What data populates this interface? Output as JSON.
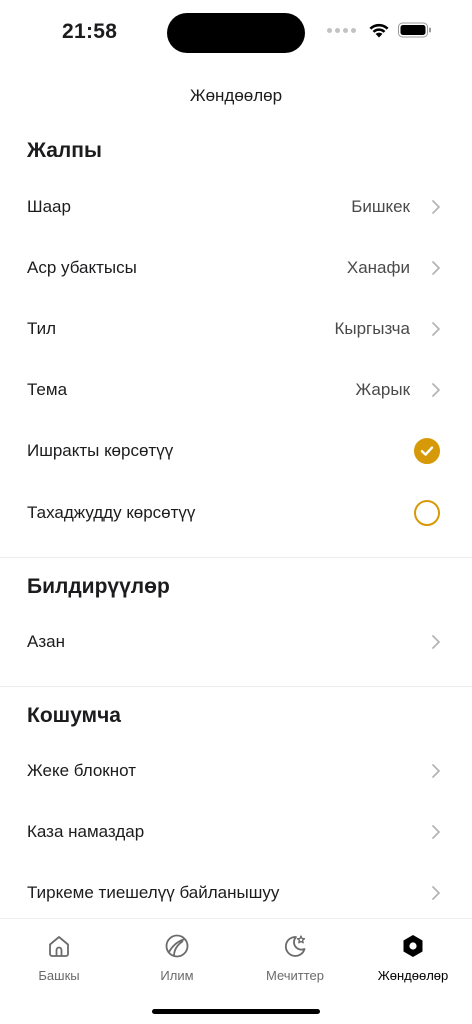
{
  "status": {
    "time": "21:58"
  },
  "nav": {
    "title": "Жөндөөлөр"
  },
  "sections": {
    "general": {
      "title": "Жалпы",
      "city": {
        "label": "Шаар",
        "value": "Бишкек"
      },
      "asr": {
        "label": "Аср убактысы",
        "value": "Ханафи"
      },
      "language": {
        "label": "Тил",
        "value": "Кыргызча"
      },
      "theme": {
        "label": "Тема",
        "value": "Жарык"
      },
      "ishraq": {
        "label": "Ишракты көрсөтүү",
        "checked": true
      },
      "tahajjud": {
        "label": "Тахаджудду көрсөтүү",
        "checked": false
      }
    },
    "notifications": {
      "title": "Билдирүүлөр",
      "azan": {
        "label": "Азан"
      }
    },
    "extra": {
      "title": "Кошумча",
      "notebook": {
        "label": "Жеке блокнот"
      },
      "qada": {
        "label": "Каза намаздар"
      },
      "contact": {
        "label": "Тиркеме тиешелүү байланышуу"
      }
    }
  },
  "tabbar": {
    "home": {
      "label": "Башкы",
      "icon": "house-icon"
    },
    "knowledge": {
      "label": "Илим",
      "icon": "globe-icon"
    },
    "mosques": {
      "label": "Мечиттер",
      "icon": "moon-star-icon"
    },
    "settings": {
      "label": "Жөндөөлөр",
      "icon": "gear-icon"
    }
  },
  "colors": {
    "accent": "#d69a09",
    "text": "#1c1c1e",
    "secondary": "#4a4a4a"
  }
}
